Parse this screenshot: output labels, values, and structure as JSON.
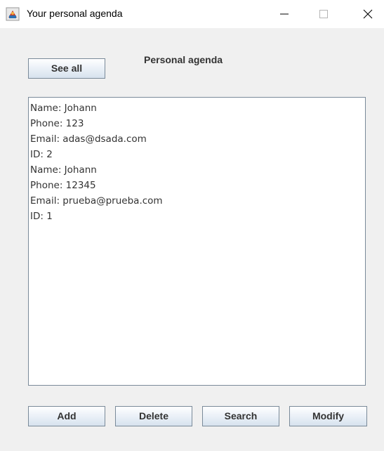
{
  "window": {
    "title": "Your personal agenda",
    "icon": "java-app-icon",
    "controls": {
      "minimize_icon": "minimize-icon",
      "maximize_icon": "maximize-icon",
      "close_icon": "close-icon"
    }
  },
  "header": {
    "label": "Personal agenda"
  },
  "toolbar": {
    "see_all_label": "See all"
  },
  "output": {
    "lines": [
      "Name: Johann",
      "Phone: 123",
      "Email: adas@dsada.com",
      "ID: 2",
      "Name: Johann",
      "Phone: 12345",
      "Email: prueba@prueba.com",
      "ID: 1"
    ]
  },
  "actions": {
    "add_label": "Add",
    "delete_label": "Delete",
    "search_label": "Search",
    "modify_label": "Modify"
  },
  "colors": {
    "background": "#f0f0f0",
    "titlebar": "#ffffff",
    "text": "#333333",
    "button_border": "#7a8a99"
  }
}
